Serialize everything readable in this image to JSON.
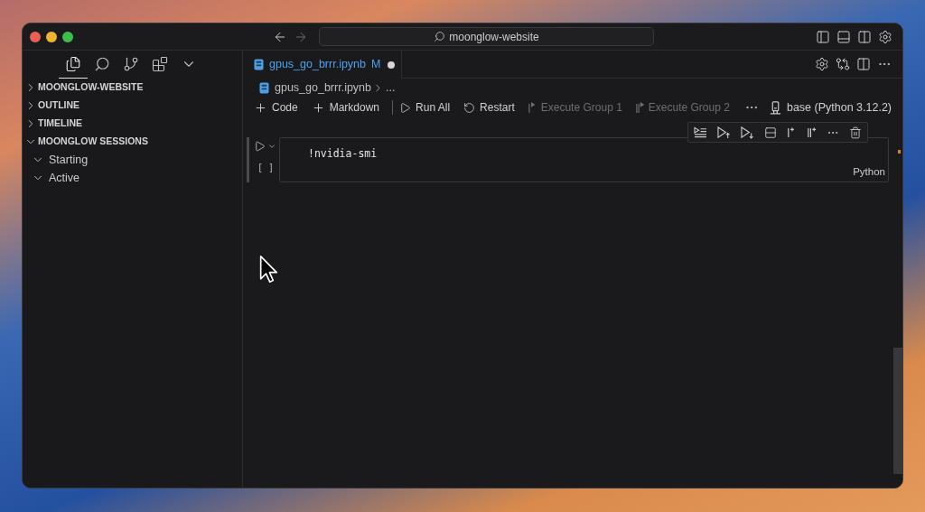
{
  "title_bar": {
    "navigation": [
      {
        "kind": "back",
        "disabled": false
      },
      {
        "kind": "forward",
        "disabled": true
      }
    ],
    "search": "moonglow-website"
  },
  "activity_bar": [
    {
      "selected": true
    },
    {
      "selected": false
    },
    {
      "selected": false
    },
    {
      "selected": false
    },
    {
      "selected": false
    }
  ],
  "sidebar": {
    "sections": [
      {
        "title": "MOONGLOW-WEBSITE",
        "expanded": false
      },
      {
        "title": "OUTLINE",
        "expanded": false
      },
      {
        "title": "TIMELINE",
        "expanded": false
      },
      {
        "title": "MOONGLOW SESSIONS",
        "expanded": true,
        "children": [
          {
            "label": "Starting",
            "expanded": true
          },
          {
            "label": "Active",
            "expanded": true
          }
        ]
      }
    ]
  },
  "editor": {
    "tabs": [
      {
        "label": "gpus_go_brrr.ipynb",
        "badge": "M",
        "modified": true,
        "selected": true
      }
    ],
    "breadcrumbs": [
      "gpus_go_brrr.ipynb",
      "..."
    ],
    "toolbar": [
      {
        "kind": "add",
        "label": "Code",
        "disabled": false
      },
      {
        "kind": "add",
        "label": "Markdown",
        "disabled": false
      },
      {
        "kind": "run",
        "label": "Run All",
        "disabled": false
      },
      {
        "kind": "restart",
        "label": "Restart",
        "disabled": false
      },
      {
        "kind": "group",
        "label": "Execute Group 1",
        "disabled": true
      },
      {
        "kind": "groups",
        "label": "Execute Group 2",
        "disabled": true
      }
    ],
    "kernel": "base (Python 3.12.2)",
    "cells": [
      {
        "execution_count": "[ ]",
        "source": "!nvidia-smi",
        "language": "Python",
        "focused": true
      }
    ]
  }
}
